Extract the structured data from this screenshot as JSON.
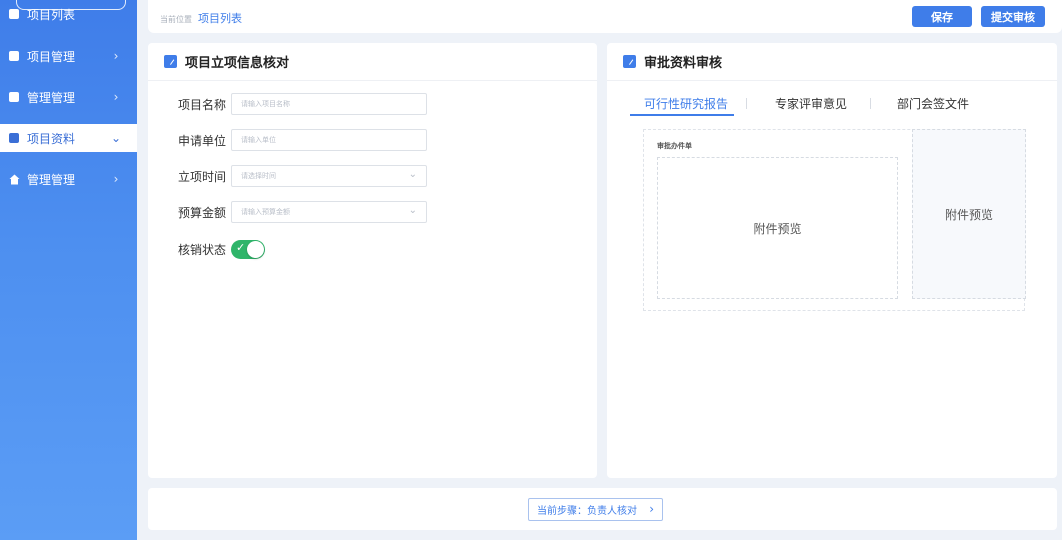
{
  "sidebar": {
    "items": [
      {
        "label": "项目列表",
        "icon": "document-icon",
        "active": false
      },
      {
        "label": "项目管理",
        "icon": "briefcase-icon",
        "active": false
      },
      {
        "label": "管理管理",
        "icon": "list-icon",
        "active": false
      },
      {
        "label": "项目资料",
        "icon": "folder-icon",
        "active": true
      },
      {
        "label": "管理管理",
        "icon": "home-icon",
        "active": false
      }
    ]
  },
  "header": {
    "breadcrumb_prefix": "当前位置",
    "breadcrumb_current": "项目列表",
    "save_label": "保存",
    "submit_label": "提交审核"
  },
  "left_panel": {
    "title": "项目立项信息核对",
    "fields": [
      {
        "label": "项目名称",
        "placeholder": "请输入项目名称"
      },
      {
        "label": "申请单位",
        "placeholder": "请输入单位"
      },
      {
        "label": "立项时间",
        "placeholder": "请选择时间"
      },
      {
        "label": "预算金额",
        "placeholder": "请输入预算金额"
      }
    ],
    "status_label": "核销状态",
    "status_on": true
  },
  "right_panel": {
    "title": "审批资料审核",
    "tabs": [
      "可行性研究报告",
      "专家评审意见",
      "部门会签文件"
    ],
    "active_tab": 0,
    "attachment_title": "审批办件单",
    "preview_main": "附件预览",
    "preview_side": "附件预览"
  },
  "footer": {
    "step_label": "当前步骤：负责人核对"
  },
  "colors": {
    "accent": "#3f7de9",
    "toggle_on": "#2fb56a"
  }
}
